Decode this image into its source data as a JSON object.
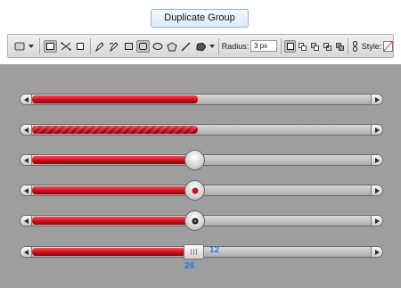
{
  "top": {
    "duplicate_button": "Duplicate Group"
  },
  "toolbar": {
    "radius_label": "Radius:",
    "radius_value": "3 px",
    "style_label": "Style:",
    "icons": [
      "shape-tool-icon",
      "dropdown-arrow-icon",
      "shape-layers-icon",
      "paths-icon",
      "fill-pixels-icon",
      "pen-icon",
      "freeform-pen-icon",
      "rectangle-icon",
      "rounded-rectangle-icon",
      "ellipse-icon",
      "polygon-icon",
      "line-icon",
      "custom-shape-icon",
      "new-layer-icon",
      "add-icon",
      "subtract-icon",
      "intersect-icon",
      "exclude-icon",
      "link-icon",
      "style-swatch-icon"
    ]
  },
  "sliders": [
    {
      "name": "slider-plain",
      "fill": 0.46,
      "knob": "none"
    },
    {
      "name": "slider-striped",
      "fill": 0.46,
      "knob": "none"
    },
    {
      "name": "slider-knob-plain",
      "fill": 0.46,
      "knob": "plain"
    },
    {
      "name": "slider-knob-red-dot",
      "fill": 0.46,
      "knob": "red-dot"
    },
    {
      "name": "slider-knob-dark-dot",
      "fill": 0.46,
      "knob": "dark-dot"
    },
    {
      "name": "slider-handle-measured",
      "fill": 0.46,
      "knob": "handle"
    }
  ],
  "measurements": {
    "width": "26",
    "height": "12"
  },
  "colors": {
    "accent_red": "#c4101c",
    "measure_blue": "#1a7fe0",
    "canvas_gray": "#9e9e9e"
  }
}
